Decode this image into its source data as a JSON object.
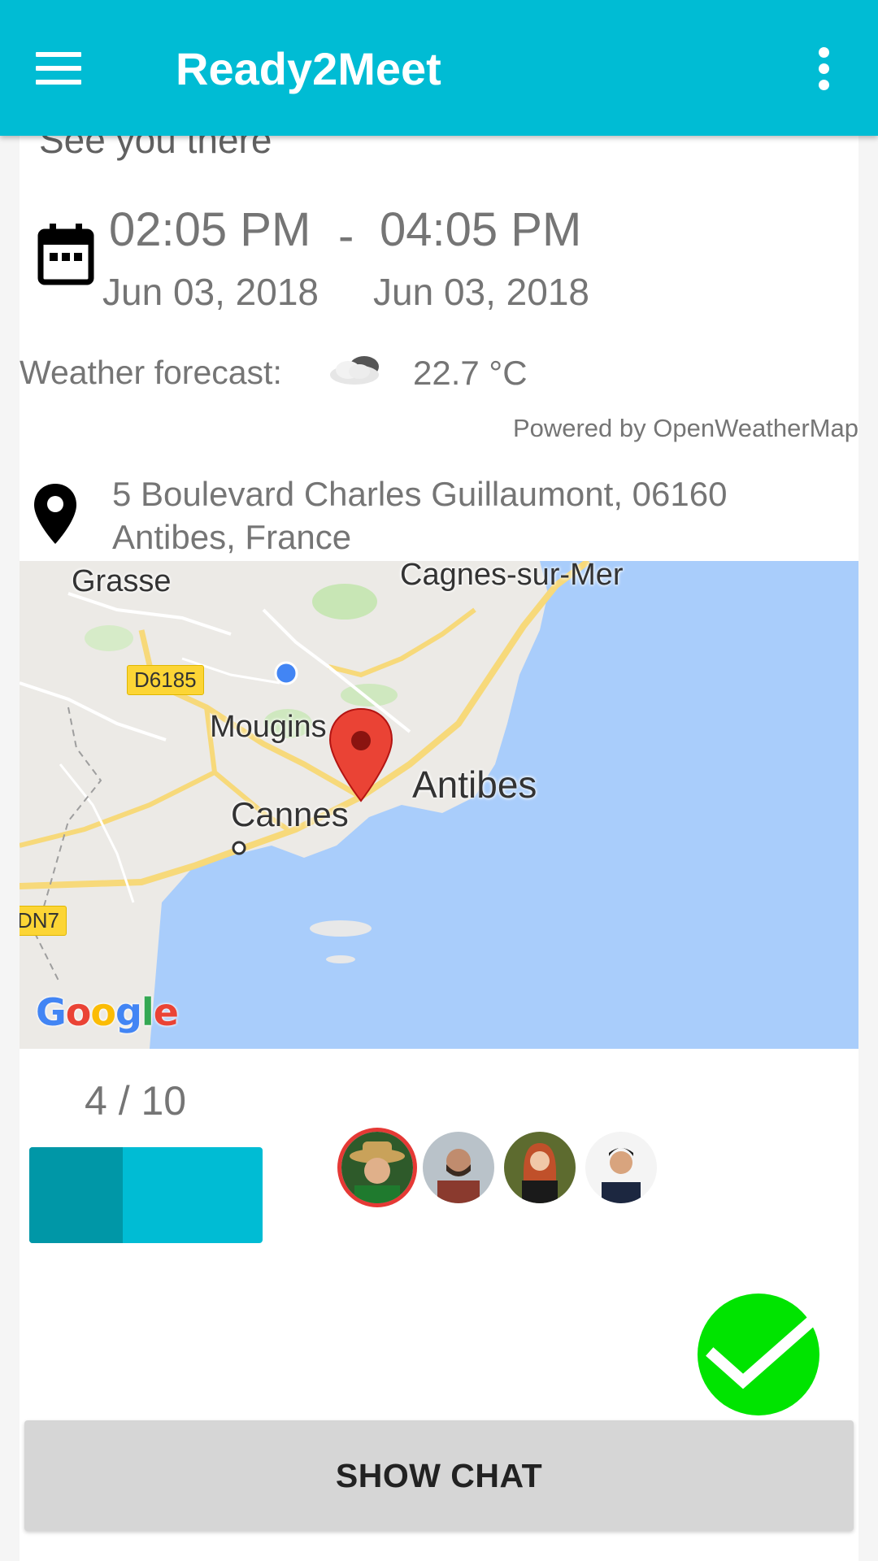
{
  "app": {
    "title": "Ready2Meet"
  },
  "event": {
    "headline": "See you there",
    "start_time": "02:05 PM",
    "end_time": "04:05 PM",
    "separator": "-",
    "start_date": "Jun 03, 2018",
    "end_date": "Jun 03, 2018"
  },
  "weather": {
    "label": "Weather forecast:",
    "icon": "cloudy-icon",
    "temperature": "22.7 °C",
    "attribution": "Powered by OpenWeatherMap"
  },
  "location": {
    "address": "5 Boulevard Charles Guillaumont, 06160 Antibes, France"
  },
  "map": {
    "places": [
      "Grasse",
      "Cagnes-sur-Mer",
      "Mougins",
      "Antibes",
      "Cannes"
    ],
    "roads": [
      "D6185",
      "DN7"
    ],
    "provider": "Google"
  },
  "participants": {
    "count_label": "4 / 10",
    "current": 4,
    "max": 10,
    "avatars": [
      "participant-1",
      "participant-2",
      "participant-3",
      "participant-4"
    ]
  },
  "actions": {
    "show_chat": "SHOW CHAT"
  },
  "colors": {
    "primary": "#00bcd4",
    "primary_dark": "#0097a7",
    "accept": "#00e400",
    "pin": "#ea4335",
    "host_ring": "#e53935"
  }
}
